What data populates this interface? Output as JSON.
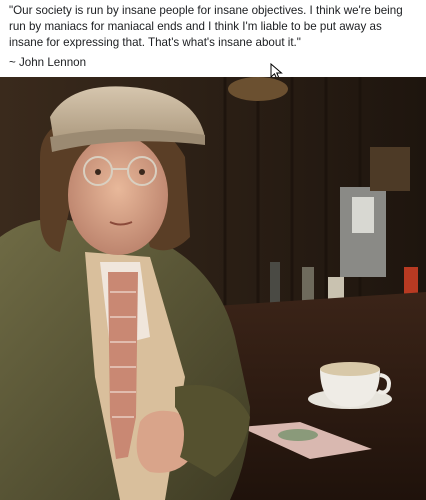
{
  "post": {
    "quote": "\"Our society is run by insane people for insane objectives. I think we're being run by maniacs for maniacal ends and I think I'm liable to be put away as insane for expressing that. That's what's insane about it.\"",
    "attribution": "~ John Lennon"
  },
  "image": {
    "icon": "photo-icon"
  },
  "colors": {
    "text": "#1c1e21",
    "background": "#ffffff",
    "photo_dark": "#2a1d14"
  }
}
